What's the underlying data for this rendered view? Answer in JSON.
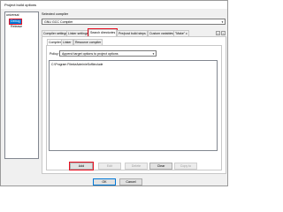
{
  "window": {
    "title": "Project build options"
  },
  "tree": {
    "root": "universal",
    "selected": "Debug",
    "child2": "Release"
  },
  "main": {
    "selected_compiler_label": "Selected compiler",
    "compiler_value": "GNU GCC Compiler",
    "tabs": [
      {
        "label": "Compiler settings"
      },
      {
        "label": "Linker settings"
      },
      {
        "label": "Search directories"
      },
      {
        "label": "Pre/post build steps"
      },
      {
        "label": "Custom variables"
      },
      {
        "label": "\"Make\" c"
      }
    ],
    "tab_prev": "<",
    "tab_next": ">",
    "subtabs": [
      {
        "label": "Compiler"
      },
      {
        "label": "Linker"
      },
      {
        "label": "Resource compiler"
      }
    ],
    "policy_label": "Policy:",
    "policy_value": "Append target options to project options",
    "directories": [
      "C:\\Program Files\\eAdmin\\eSoft\\include"
    ]
  },
  "buttons": {
    "add": "Add",
    "edit": "Edit",
    "delete": "Delete",
    "clear": "Clear",
    "copy_to": "Copy to",
    "ok": "OK",
    "cancel": "Cancel"
  },
  "colors": {
    "selection": "#0078d7",
    "highlight_box": "#e81123"
  }
}
